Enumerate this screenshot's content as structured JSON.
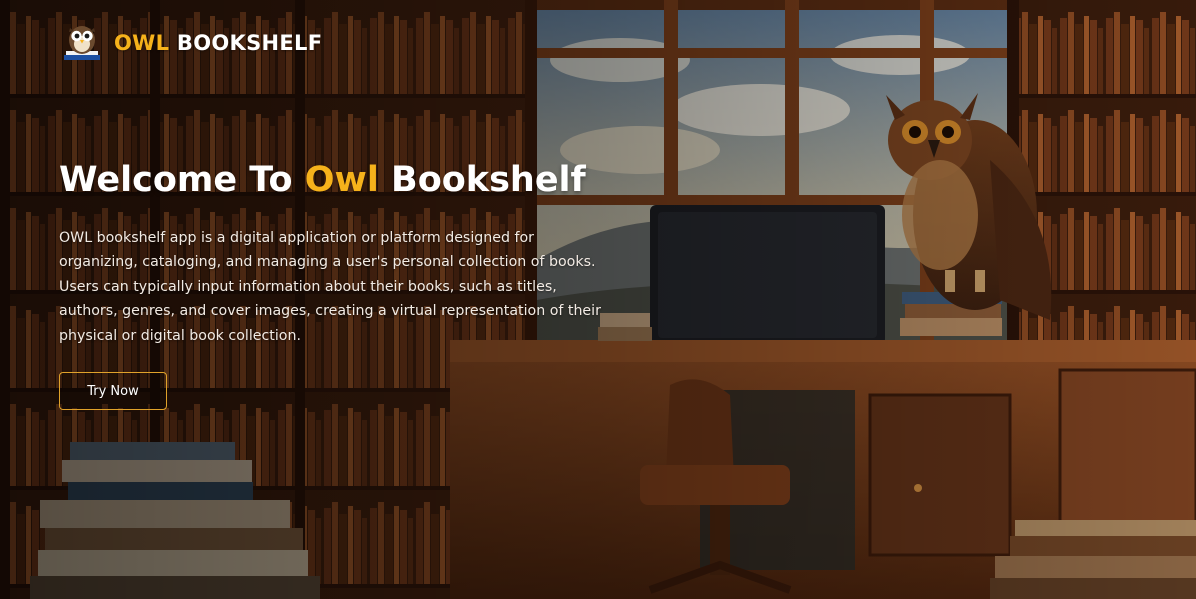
{
  "brand": {
    "accent": "OWL",
    "rest": " BOOKSHELF"
  },
  "hero": {
    "title_before": "Welcome To ",
    "title_accent": "Owl",
    "title_after": " Bookshelf",
    "description": "OWL bookshelf app is a digital application or platform designed for organizing, cataloging, and managing a user's personal collection of books. Users can typically input information about their books, such as titles, authors, genres, and cover images, creating a virtual representation of their physical or digital book collection.",
    "cta_label": "Try Now"
  },
  "icons": {
    "logo": "owl-on-books-icon"
  },
  "colors": {
    "accent": "#f6b21b",
    "text": "#ffffff",
    "button_border": "#e0a22a"
  }
}
